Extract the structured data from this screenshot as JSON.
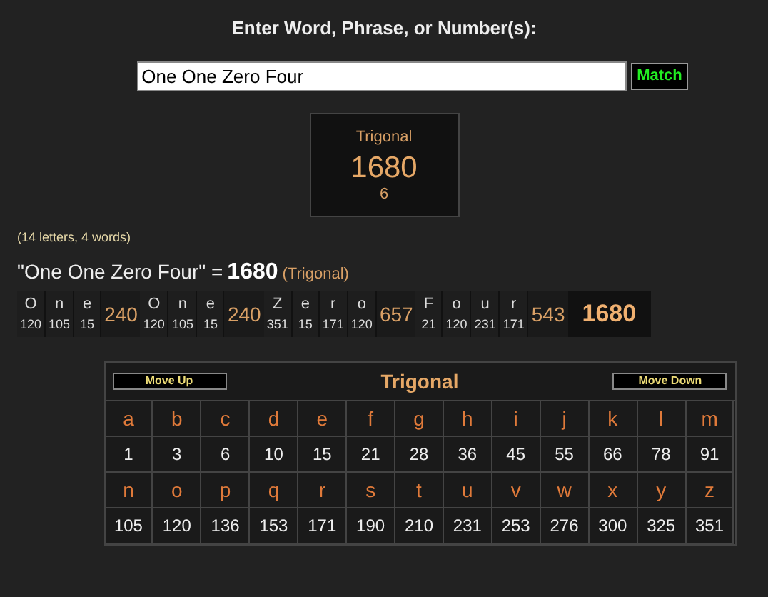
{
  "heading": "Enter Word, Phrase, or Number(s):",
  "search": {
    "value": "One One Zero Four"
  },
  "match_button": "Match",
  "result_card": {
    "cipher": "Trigonal",
    "value": "1680",
    "reduction": "6"
  },
  "stats": "(14 letters, 4 words)",
  "summary": {
    "phrase": "\"One One Zero Four\" =",
    "value": "1680",
    "cipher": "(Trigonal)"
  },
  "breakdown": {
    "words": [
      {
        "letters": [
          {
            "char": "O",
            "value": "120"
          },
          {
            "char": "n",
            "value": "105"
          },
          {
            "char": "e",
            "value": "15"
          }
        ],
        "total": "240"
      },
      {
        "letters": [
          {
            "char": "O",
            "value": "120"
          },
          {
            "char": "n",
            "value": "105"
          },
          {
            "char": "e",
            "value": "15"
          }
        ],
        "total": "240"
      },
      {
        "letters": [
          {
            "char": "Z",
            "value": "351"
          },
          {
            "char": "e",
            "value": "15"
          },
          {
            "char": "r",
            "value": "171"
          },
          {
            "char": "o",
            "value": "120"
          }
        ],
        "total": "657"
      },
      {
        "letters": [
          {
            "char": "F",
            "value": "21"
          },
          {
            "char": "o",
            "value": "120"
          },
          {
            "char": "u",
            "value": "231"
          },
          {
            "char": "r",
            "value": "171"
          }
        ],
        "total": "543"
      }
    ],
    "total": "1680"
  },
  "cipher_table": {
    "title": "Trigonal",
    "move_up": "Move Up",
    "move_down": "Move Down",
    "rows": [
      {
        "kind": "letters",
        "cells": [
          "a",
          "b",
          "c",
          "d",
          "e",
          "f",
          "g",
          "h",
          "i",
          "j",
          "k",
          "l",
          "m"
        ]
      },
      {
        "kind": "values",
        "cells": [
          "1",
          "3",
          "6",
          "10",
          "15",
          "21",
          "28",
          "36",
          "45",
          "55",
          "66",
          "78",
          "91"
        ]
      },
      {
        "kind": "letters",
        "cells": [
          "n",
          "o",
          "p",
          "q",
          "r",
          "s",
          "t",
          "u",
          "v",
          "w",
          "x",
          "y",
          "z"
        ]
      },
      {
        "kind": "values",
        "cells": [
          "105",
          "120",
          "136",
          "153",
          "171",
          "190",
          "210",
          "231",
          "253",
          "276",
          "300",
          "325",
          "351"
        ]
      }
    ]
  }
}
